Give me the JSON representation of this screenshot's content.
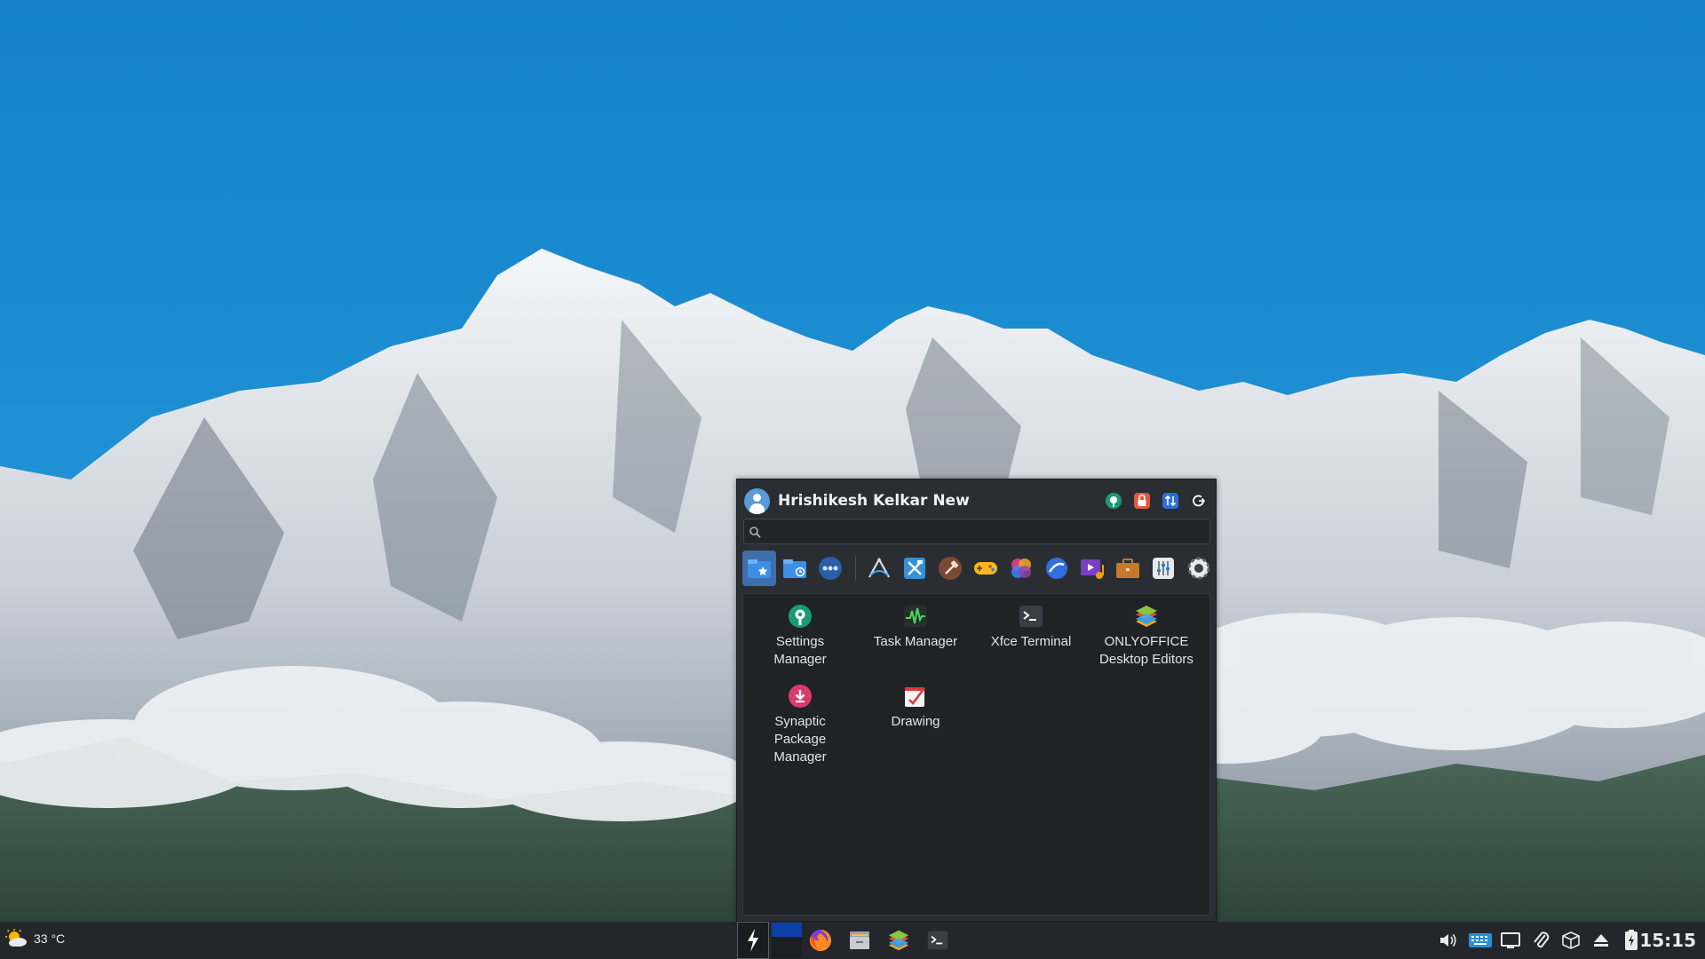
{
  "desktop": {
    "wallpaper": "snow-capped-mountains-with-clouds"
  },
  "menu": {
    "username": "Hrishikesh Kelkar New",
    "header_buttons": [
      {
        "icon": "settings-icon",
        "color": "#1b9a7a"
      },
      {
        "icon": "lock-screen-icon",
        "color": "#e2583e"
      },
      {
        "icon": "switch-user-icon",
        "color": "#2c6fd6"
      },
      {
        "icon": "log-out-icon",
        "color": "#ffffff"
      }
    ],
    "search": {
      "placeholder": "",
      "value": ""
    },
    "categories": [
      {
        "icon": "favorites-icon",
        "active": true
      },
      {
        "icon": "recently-used-icon"
      },
      {
        "icon": "all-applications-icon"
      },
      {
        "icon": "accessories-icon"
      },
      {
        "icon": "development-icon"
      },
      {
        "icon": "education-icon"
      },
      {
        "icon": "games-icon"
      },
      {
        "icon": "graphics-icon"
      },
      {
        "icon": "internet-icon"
      },
      {
        "icon": "multimedia-icon"
      },
      {
        "icon": "office-icon"
      },
      {
        "icon": "settings-category-icon"
      },
      {
        "icon": "system-icon"
      }
    ],
    "apps": [
      {
        "label": "Settings\nManager",
        "icon": "settings-manager-icon"
      },
      {
        "label": "Task Manager",
        "icon": "task-manager-icon"
      },
      {
        "label": "Xfce Terminal",
        "icon": "terminal-icon"
      },
      {
        "label": "ONLYOFFICE\nDesktop Editors",
        "icon": "onlyoffice-icon"
      },
      {
        "label": "Synaptic\nPackage\nManager",
        "icon": "synaptic-icon"
      },
      {
        "label": "Drawing",
        "icon": "drawing-icon"
      }
    ]
  },
  "taskbar": {
    "weather": {
      "temperature": "33 °C",
      "icon": "partly-sunny-icon"
    },
    "launchers": [
      "whisker-menu-icon",
      "workspace-switcher",
      "firefox-icon",
      "file-manager-icon",
      "onlyoffice-icon",
      "terminal-icon"
    ],
    "tray": [
      "volume-icon",
      "keyboard-icon",
      "display-icon",
      "clipboard-icon",
      "package-updates-icon",
      "eject-icon",
      "power-icon"
    ],
    "clock": "15:15"
  },
  "colors": {
    "menu_bg": "#2a2e33",
    "accent": "#3f6eaa",
    "taskbar_bg": "#23272b"
  }
}
